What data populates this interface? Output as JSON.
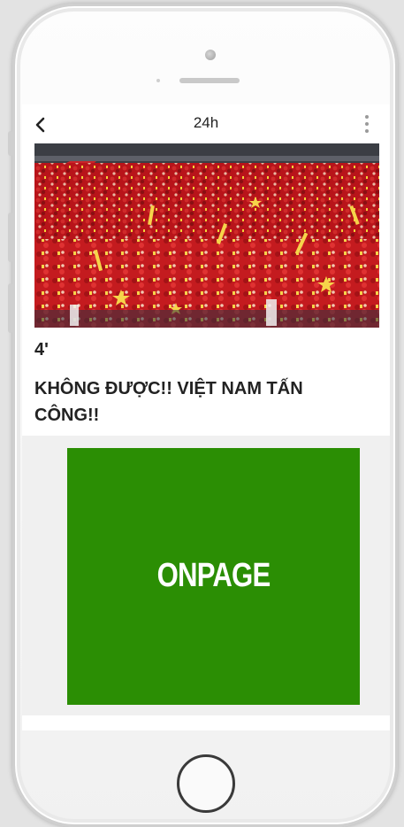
{
  "nav": {
    "title": "24h"
  },
  "article": {
    "time": "4'",
    "headline": "KHÔNG ĐƯỢC!! VIỆT NAM TẤN CÔNG!!"
  },
  "ad": {
    "label": "ONPAGE",
    "color": "#2b8e04"
  },
  "icons": [
    "back-chevron-icon",
    "more-vertical-icon"
  ]
}
